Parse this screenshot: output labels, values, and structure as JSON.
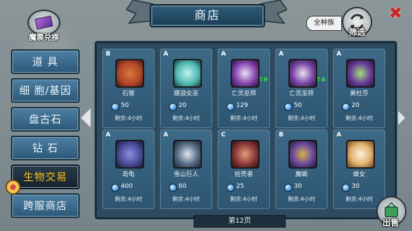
{
  "header": {
    "title": "商店"
  },
  "ticket": {
    "label": "魔票兑换"
  },
  "filter": {
    "race_label": "全种族",
    "button_label": "筛选"
  },
  "close": {
    "glyph": "✖"
  },
  "sidebar": {
    "items": [
      {
        "label": "道 具",
        "active": false
      },
      {
        "label": "细 胞/基因",
        "active": false
      },
      {
        "label": "盘古石",
        "active": false
      },
      {
        "label": "钻 石",
        "active": false
      },
      {
        "label": "生物交易",
        "active": true
      },
      {
        "label": "跨服商店",
        "active": false
      }
    ]
  },
  "cards": [
    {
      "rarity": "B",
      "name": "石猴",
      "price": "50",
      "remain": "剩余:4小时",
      "upgrade": "",
      "color": "#b0452a"
    },
    {
      "rarity": "A",
      "name": "娜迦女巫",
      "price": "20",
      "remain": "剩余:4小时",
      "upgrade": "",
      "color": "#4fb7b0"
    },
    {
      "rarity": "A",
      "name": "亡灵巫师",
      "price": "129",
      "remain": "剩余:4小时",
      "upgrade": "9",
      "color": "#8a48b3"
    },
    {
      "rarity": "A",
      "name": "亡灵巫师",
      "price": "50",
      "remain": "剩余:4小时",
      "upgrade": "4",
      "color": "#7d4aa8"
    },
    {
      "rarity": "A",
      "name": "美杜莎",
      "price": "20",
      "remain": "剩余:4小时",
      "upgrade": "",
      "color": "#6a3f9a"
    },
    {
      "rarity": "A",
      "name": "岛龟",
      "price": "400",
      "remain": "剩余:4小时",
      "upgrade": "",
      "color": "#4b4f9a"
    },
    {
      "rarity": "A",
      "name": "雪山巨人",
      "price": "60",
      "remain": "剩余:4小时",
      "upgrade": "",
      "color": "#5a6f86"
    },
    {
      "rarity": "C",
      "name": "拾荒者",
      "price": "25",
      "remain": "剩余:4小时",
      "upgrade": "",
      "color": "#8e3a3a"
    },
    {
      "rarity": "B",
      "name": "魔蝎",
      "price": "30",
      "remain": "剩余:4小时",
      "upgrade": "",
      "color": "#6b4b9e"
    },
    {
      "rarity": "A",
      "name": "蜂女",
      "price": "30",
      "remain": "剩余:4小时",
      "upgrade": "",
      "color": "#e2b270"
    }
  ],
  "pagination": {
    "label": "第12页"
  },
  "sell": {
    "label": "出售"
  }
}
